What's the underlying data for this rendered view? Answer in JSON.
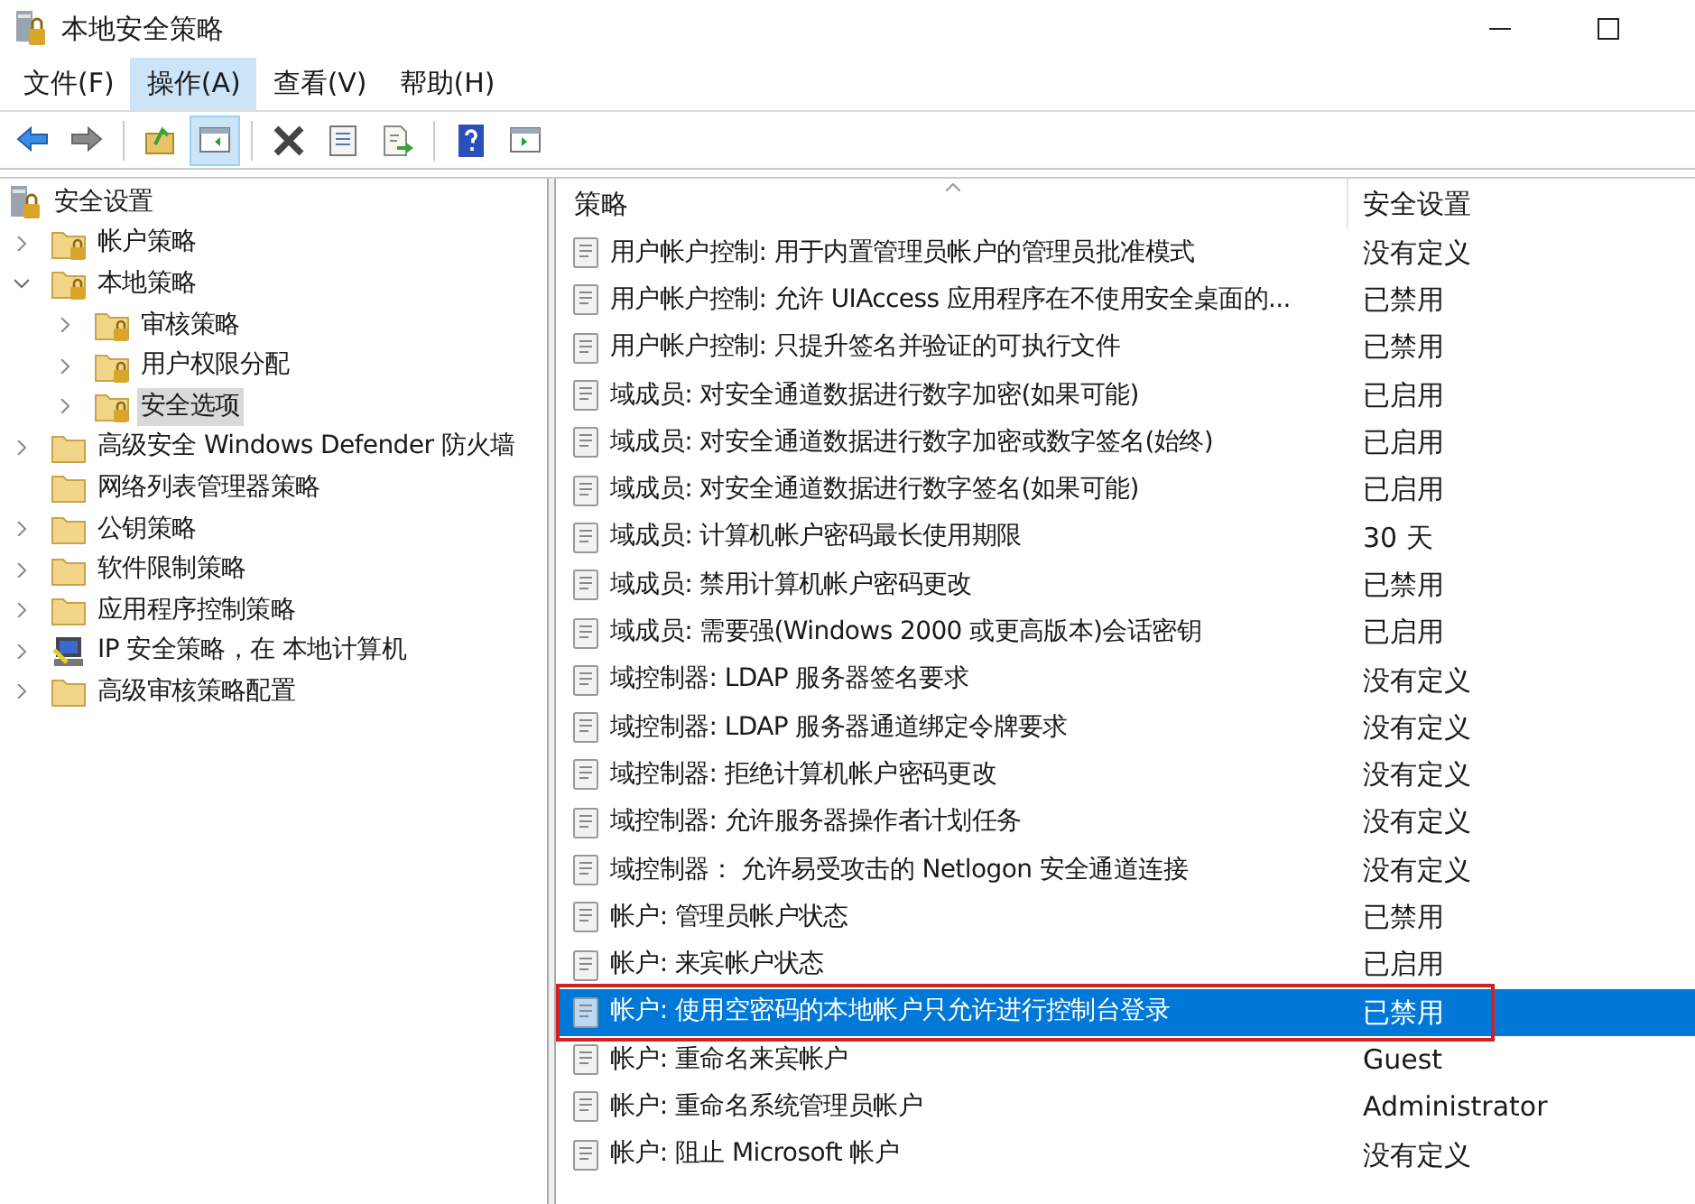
{
  "window": {
    "title": "本地安全策略"
  },
  "menu": [
    {
      "label": "文件(F)",
      "selected": false
    },
    {
      "label": "操作(A)",
      "selected": true
    },
    {
      "label": "查看(V)",
      "selected": false
    },
    {
      "label": "帮助(H)",
      "selected": false
    }
  ],
  "toolbar": [
    {
      "kind": "back",
      "pressed": false
    },
    {
      "kind": "forward",
      "pressed": false
    },
    {
      "kind": "sep"
    },
    {
      "kind": "up",
      "pressed": false
    },
    {
      "kind": "tree",
      "pressed": true
    },
    {
      "kind": "sep"
    },
    {
      "kind": "delete",
      "pressed": false
    },
    {
      "kind": "properties",
      "pressed": false
    },
    {
      "kind": "export",
      "pressed": false
    },
    {
      "kind": "sep"
    },
    {
      "kind": "help",
      "pressed": false
    },
    {
      "kind": "action",
      "pressed": false
    }
  ],
  "tree": {
    "root": {
      "label": "安全设置",
      "selected": false
    },
    "items": [
      {
        "label": "帐户策略",
        "kind": "lockfolder",
        "selected": false,
        "expanded": false
      },
      {
        "label": "本地策略",
        "kind": "lockfolder",
        "selected": false,
        "expanded": true,
        "children": [
          {
            "label": "审核策略",
            "kind": "lockfolder",
            "selected": false,
            "expanded": false
          },
          {
            "label": "用户权限分配",
            "kind": "lockfolder",
            "selected": false,
            "expanded": false
          },
          {
            "label": "安全选项",
            "kind": "lockfolder",
            "selected": true,
            "expanded": false
          }
        ]
      },
      {
        "label": "高级安全 Windows Defender 防火墙",
        "kind": "folder",
        "selected": false,
        "expanded": false
      },
      {
        "label": "网络列表管理器策略",
        "kind": "leaffolder",
        "selected": false
      },
      {
        "label": "公钥策略",
        "kind": "folder",
        "selected": false,
        "expanded": false
      },
      {
        "label": "软件限制策略",
        "kind": "folder",
        "selected": false,
        "expanded": false
      },
      {
        "label": "应用程序控制策略",
        "kind": "folder",
        "selected": false,
        "expanded": false
      },
      {
        "label": "IP 安全策略，在 本地计算机",
        "kind": "computer",
        "selected": false,
        "expanded": false
      },
      {
        "label": "高级审核策略配置",
        "kind": "folder",
        "selected": false,
        "expanded": false
      }
    ]
  },
  "table": {
    "columns": [
      "策略",
      "安全设置"
    ],
    "rows": [
      {
        "policy": "用户帐户控制: 用于内置管理员帐户的管理员批准模式",
        "setting": "没有定义",
        "selected": false
      },
      {
        "policy": "用户帐户控制: 允许 UIAccess 应用程序在不使用安全桌面的...",
        "setting": "已禁用",
        "selected": false
      },
      {
        "policy": "用户帐户控制: 只提升签名并验证的可执行文件",
        "setting": "已禁用",
        "selected": false
      },
      {
        "policy": "域成员: 对安全通道数据进行数字加密(如果可能)",
        "setting": "已启用",
        "selected": false
      },
      {
        "policy": "域成员: 对安全通道数据进行数字加密或数字签名(始终)",
        "setting": "已启用",
        "selected": false
      },
      {
        "policy": "域成员: 对安全通道数据进行数字签名(如果可能)",
        "setting": "已启用",
        "selected": false
      },
      {
        "policy": "域成员: 计算机帐户密码最长使用期限",
        "setting": "30 天",
        "selected": false
      },
      {
        "policy": "域成员: 禁用计算机帐户密码更改",
        "setting": "已禁用",
        "selected": false
      },
      {
        "policy": "域成员: 需要强(Windows 2000 或更高版本)会话密钥",
        "setting": "已启用",
        "selected": false
      },
      {
        "policy": "域控制器: LDAP 服务器签名要求",
        "setting": "没有定义",
        "selected": false
      },
      {
        "policy": "域控制器: LDAP 服务器通道绑定令牌要求",
        "setting": "没有定义",
        "selected": false
      },
      {
        "policy": "域控制器: 拒绝计算机帐户密码更改",
        "setting": "没有定义",
        "selected": false
      },
      {
        "policy": "域控制器: 允许服务器操作者计划任务",
        "setting": "没有定义",
        "selected": false
      },
      {
        "policy": "域控制器： 允许易受攻击的 Netlogon 安全通道连接",
        "setting": "没有定义",
        "selected": false
      },
      {
        "policy": "帐户: 管理员帐户状态",
        "setting": "已禁用",
        "selected": false
      },
      {
        "policy": "帐户: 来宾帐户状态",
        "setting": "已启用",
        "selected": false
      },
      {
        "policy": "帐户: 使用空密码的本地帐户只允许进行控制台登录",
        "setting": "已禁用",
        "selected": true,
        "annotated": true
      },
      {
        "policy": "帐户: 重命名来宾帐户",
        "setting": "Guest",
        "selected": false
      },
      {
        "policy": "帐户: 重命名系统管理员帐户",
        "setting": "Administrator",
        "selected": false
      },
      {
        "policy": "帐户: 阻止 Microsoft 帐户",
        "setting": "没有定义",
        "selected": false
      }
    ]
  }
}
